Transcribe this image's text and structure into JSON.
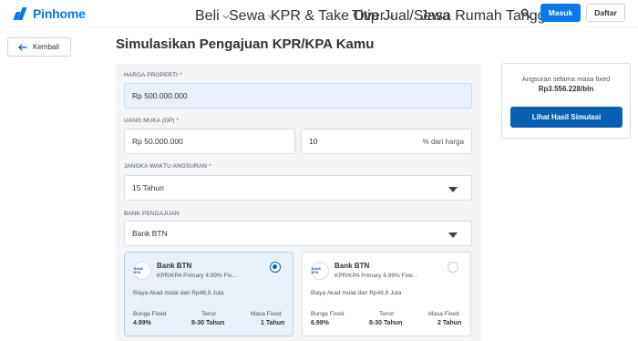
{
  "navbar": {
    "logo_text": "Pinhome",
    "menu": [
      {
        "label": "Beli",
        "dropdown": true
      },
      {
        "label": "Sewa",
        "dropdown": true
      },
      {
        "label": "KPR & Take Over",
        "dropdown": true
      },
      {
        "label": "Titip Jual/Sewa",
        "dropdown": false
      },
      {
        "label": "Jasa Rumah Tangga",
        "dropdown": true
      }
    ],
    "login_label": "Masuk",
    "register_label": "Daftar"
  },
  "back_label": "Kembali",
  "page_title": "Simulasikan Pengajuan KPR/KPA Kamu",
  "form": {
    "property_price": {
      "label": "HARGA PROPERTI",
      "value": "Rp 500.000.000"
    },
    "down_payment": {
      "label": "UANG MUKA (DP)",
      "value": "Rp 50.000.000",
      "percent": "10",
      "percent_suffix": "% dari harga"
    },
    "tenor": {
      "label": "JANGKA WAKTU ANGSURAN",
      "value": "15 Tahun"
    },
    "bank": {
      "label": "BANK PENGAJUAN",
      "value": "Bank BTN"
    },
    "required_mark": "*"
  },
  "bank_cards": [
    {
      "name": "Bank BTN",
      "logo_text": "BANK BTN",
      "product": "KPR/KPA Primary 4.99% Fix...",
      "fee": "Biaya Akad mulai dari Rp48,9 Juta",
      "bunga_label": "Bunga Fixed",
      "bunga_value": "4.99%",
      "tenor_label": "Tenor",
      "tenor_value": "8-30 Tahun",
      "masa_label": "Masa Fixed",
      "masa_value": "1 Tahun",
      "selected": true
    },
    {
      "name": "Bank BTN",
      "logo_text": "BANK BTN",
      "product": "KPR/KPA Primary 6.99% Fixe...",
      "fee": "Biaya Akad mulai dari Rp48,9 Juta",
      "bunga_label": "Bunga Fixed",
      "bunga_value": "6.99%",
      "tenor_label": "Tenor",
      "tenor_value": "8-30 Tahun",
      "masa_label": "Masa Fixed",
      "masa_value": "2 Tahun",
      "selected": false
    }
  ],
  "summary": {
    "label": "Angsuran selama masa fixed",
    "value": "Rp3.556.228/bln",
    "button_label": "Lihat Hasil Simulasi"
  },
  "colors": {
    "brand": "#0a78e8",
    "primary_button": "#0a5fb0",
    "panel_bg": "#f3f5f7",
    "selected_card_bg": "#e8f1f9",
    "required": "#e02f2f"
  }
}
